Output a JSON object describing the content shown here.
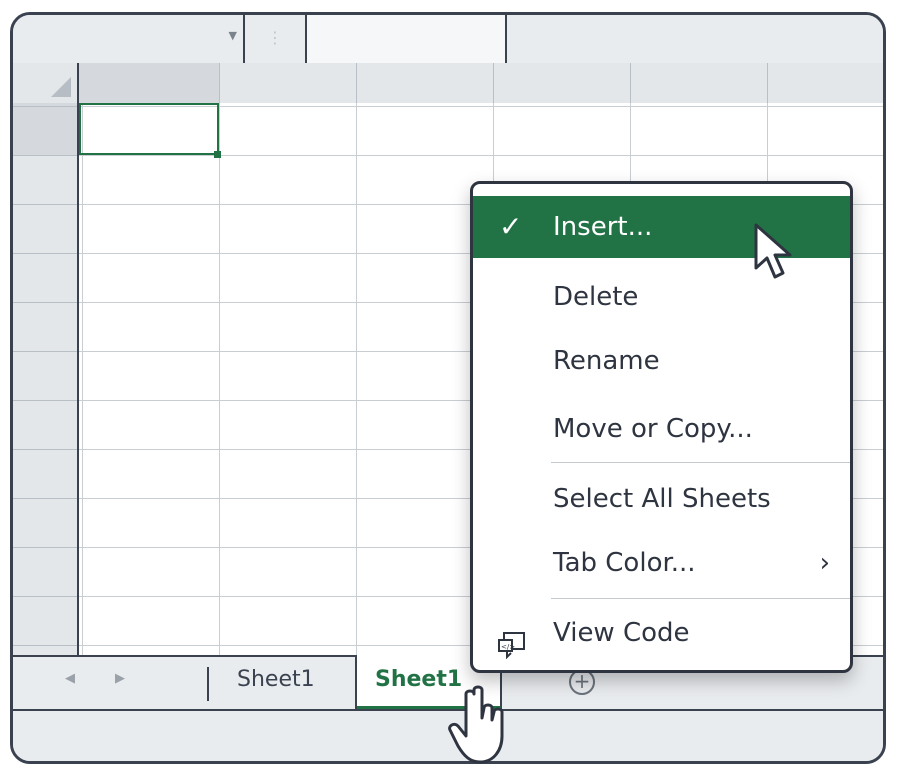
{
  "window": {
    "formula_bar": {
      "name_box_value": "",
      "formula_value": ""
    }
  },
  "sheet_tabs": [
    {
      "label": "Sheet1",
      "active": false
    },
    {
      "label": "Sheet1",
      "active": true
    }
  ],
  "context_menu": {
    "items": [
      {
        "label": "Insert...",
        "checked": true,
        "highlighted": true
      },
      {
        "label": "Delete"
      },
      {
        "label": "Rename"
      },
      {
        "label": "Move or Copy..."
      },
      {
        "label": "Select All Sheets"
      },
      {
        "label": "Tab Color...",
        "has_submenu": true
      },
      {
        "label": "View Code",
        "icon": "view-code-icon"
      }
    ]
  },
  "colors": {
    "accent": "#217346",
    "border": "#3a4250"
  }
}
